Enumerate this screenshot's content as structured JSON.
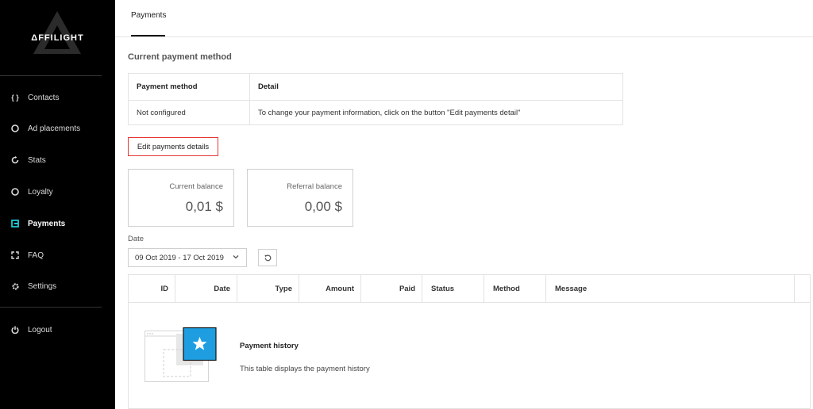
{
  "brand": {
    "name": "ΔFFILIGHT"
  },
  "sidebar": {
    "items": [
      {
        "label": "Contacts",
        "icon": "braces-icon"
      },
      {
        "label": "Ad placements",
        "icon": "circle-icon"
      },
      {
        "label": "Stats",
        "icon": "refresh-icon"
      },
      {
        "label": "Loyalty",
        "icon": "circle-icon"
      },
      {
        "label": "Payments",
        "icon": "payment-icon",
        "active": true,
        "accent": "#1ec9d3"
      },
      {
        "label": "FAQ",
        "icon": "expand-icon"
      },
      {
        "label": "Settings",
        "icon": "gear-icon"
      }
    ],
    "logout": {
      "label": "Logout",
      "icon": "power-icon"
    }
  },
  "tabs": [
    {
      "label": "Payments",
      "active": true
    }
  ],
  "payment_method": {
    "section_title": "Current payment method",
    "headers": [
      "Payment method",
      "Detail"
    ],
    "row": [
      "Not configured",
      "To change your payment information, click on the button \"Edit payments detail\""
    ],
    "edit_button": "Edit payments details"
  },
  "balances": [
    {
      "label": "Current balance",
      "value": "0,01 $"
    },
    {
      "label": "Referral balance",
      "value": "0,00 $"
    }
  ],
  "filter": {
    "date_label": "Date",
    "date_range": "09 Oct 2019 - 17 Oct 2019"
  },
  "history": {
    "columns": [
      "ID",
      "Date",
      "Type",
      "Amount",
      "Paid",
      "Status",
      "Method",
      "Message"
    ],
    "empty_title": "Payment history",
    "empty_description": "This table displays the payment history",
    "accent": "#1e9ee0"
  }
}
